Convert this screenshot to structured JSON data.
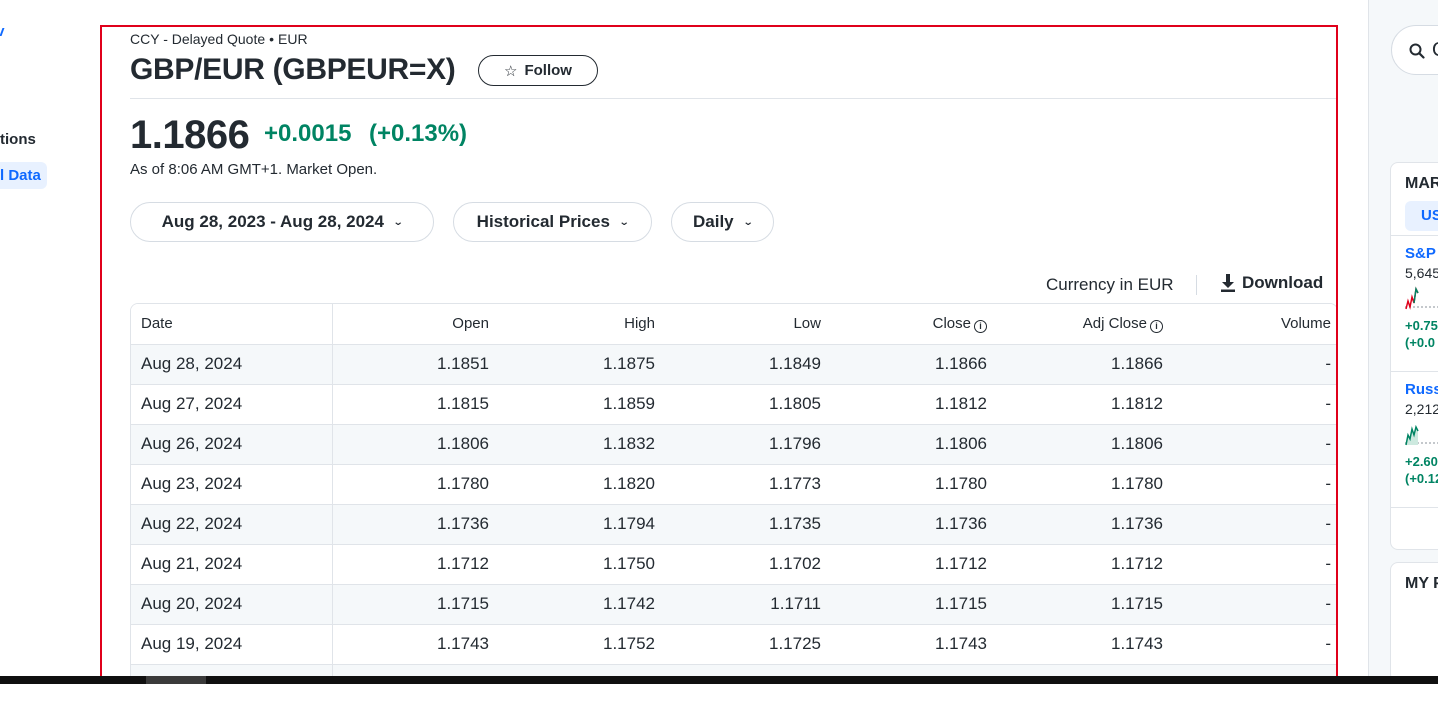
{
  "left_nav": {
    "item_options": "tions",
    "item_historical": "l Data"
  },
  "quote": {
    "exchange_line": "CCY - Delayed Quote",
    "currency_tag": "EUR",
    "title": "GBP/EUR (GBPEUR=X)",
    "follow_label": "Follow",
    "price": "1.1866",
    "change": "+0.0015",
    "change_percent": "(+0.13%)",
    "as_of": "As of 8:06 AM GMT+1. Market Open."
  },
  "filters": {
    "date_range": "Aug 28, 2023 - Aug 28, 2024",
    "data_type": "Historical Prices",
    "frequency": "Daily"
  },
  "table_toolbar": {
    "currency_note": "Currency in EUR",
    "download_label": "Download"
  },
  "table": {
    "headers": [
      "Date",
      "Open",
      "High",
      "Low",
      "Close",
      "Adj Close",
      "Volume"
    ],
    "rows": [
      [
        "Aug 28, 2024",
        "1.1851",
        "1.1875",
        "1.1849",
        "1.1866",
        "1.1866",
        "-"
      ],
      [
        "Aug 27, 2024",
        "1.1815",
        "1.1859",
        "1.1805",
        "1.1812",
        "1.1812",
        "-"
      ],
      [
        "Aug 26, 2024",
        "1.1806",
        "1.1832",
        "1.1796",
        "1.1806",
        "1.1806",
        "-"
      ],
      [
        "Aug 23, 2024",
        "1.1780",
        "1.1820",
        "1.1773",
        "1.1780",
        "1.1780",
        "-"
      ],
      [
        "Aug 22, 2024",
        "1.1736",
        "1.1794",
        "1.1735",
        "1.1736",
        "1.1736",
        "-"
      ],
      [
        "Aug 21, 2024",
        "1.1712",
        "1.1750",
        "1.1702",
        "1.1712",
        "1.1712",
        "-"
      ],
      [
        "Aug 20, 2024",
        "1.1715",
        "1.1742",
        "1.1711",
        "1.1715",
        "1.1715",
        "-"
      ],
      [
        "Aug 19, 2024",
        "1.1743",
        "1.1752",
        "1.1725",
        "1.1743",
        "1.1743",
        "-"
      ]
    ]
  },
  "right_rail": {
    "search_placeholder": "Q",
    "markets_title": "MAR",
    "markets_tab": "US",
    "indices": [
      {
        "name": "S&P",
        "value": "5,645",
        "change": "+0.75",
        "change_percent": "(+0.0"
      },
      {
        "name": "Russ",
        "value": "2,212",
        "change": "+2.60",
        "change_percent": "(+0.12"
      }
    ],
    "portfolio_title": "MY P"
  },
  "colors": {
    "positive": "#008463",
    "link_blue": "#0f69ff",
    "highlight_border": "#e0001b"
  }
}
